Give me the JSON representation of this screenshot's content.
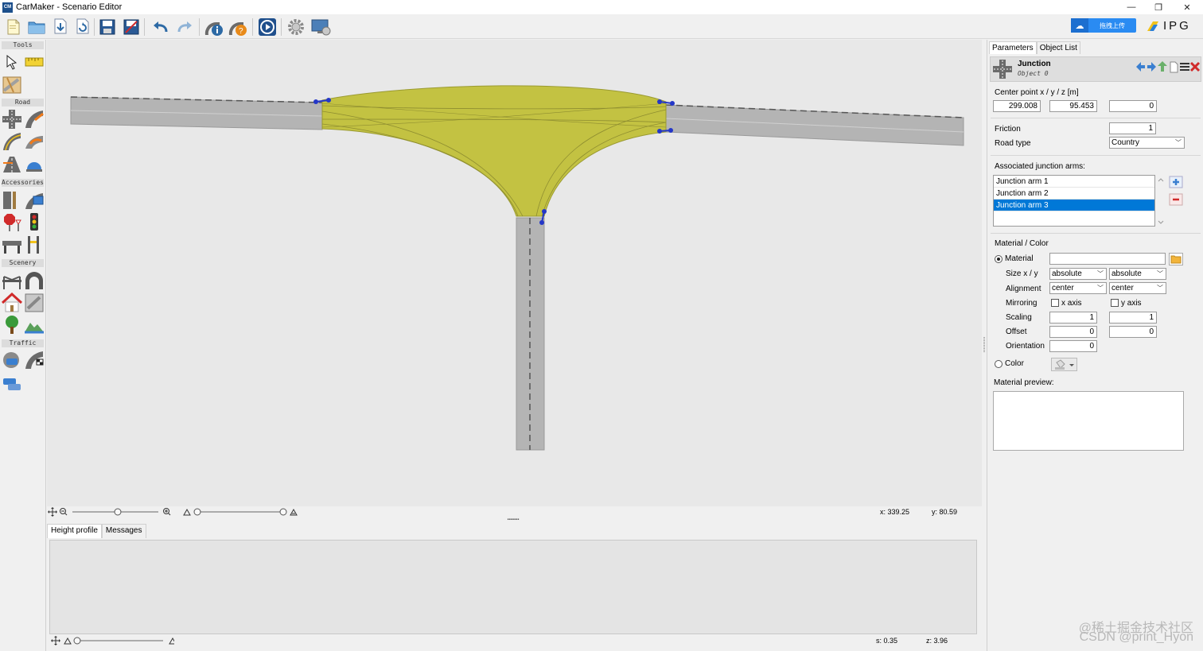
{
  "window": {
    "app_icon": "CM",
    "title": "CarMaker - Scenario Editor",
    "controls": [
      "—",
      "❐",
      "✕"
    ]
  },
  "toolbar": {
    "cloud_button": "拖拽上传",
    "brand": "IPG"
  },
  "left_panel": {
    "sections": [
      "Tools",
      "Road",
      "Accessories",
      "Scenery",
      "Traffic"
    ]
  },
  "canvas_status": {
    "x_label": "x: 339.25",
    "y_label": "y: 80.59"
  },
  "bottom": {
    "tabs": [
      "Height profile",
      "Messages"
    ],
    "s_label": "s: 0.35",
    "z_label": "z: 3.96"
  },
  "right_panel": {
    "tabs": [
      "Parameters",
      "Object List"
    ],
    "object_title": "Junction",
    "object_subtitle": "Object 0",
    "center_point_label": "Center point  x / y / z   [m]",
    "center_x": "299.008",
    "center_y": "95.453",
    "center_z": "0",
    "friction_label": "Friction",
    "friction_value": "1",
    "road_type_label": "Road type",
    "road_type_value": "Country",
    "arms_label": "Associated junction arms:",
    "arms": [
      "Junction arm 1",
      "Junction arm 2",
      "Junction arm 3"
    ],
    "material_color_label": "Material / Color",
    "material_label": "Material",
    "material_value": "",
    "size_label": "Size x / y",
    "size_x": "absolute",
    "size_y": "absolute",
    "alignment_label": "Alignment",
    "align_x": "center",
    "align_y": "center",
    "mirroring_label": "Mirroring",
    "mirror_x": "x axis",
    "mirror_y": "y axis",
    "scaling_label": "Scaling",
    "scaling_x": "1",
    "scaling_y": "1",
    "offset_label": "Offset",
    "offset_x": "0",
    "offset_y": "0",
    "orientation_label": "Orientation",
    "orientation_value": "0",
    "color_label": "Color",
    "material_preview_label": "Material preview:"
  },
  "watermark": {
    "line1": "@稀土掘金技术社区",
    "line2": "CSDN @print_Hyon"
  },
  "colors": {
    "junction_fill": "#c3c242",
    "road_gray": "#b4b4b4",
    "selection": "#0078d7",
    "handle_blue": "#2437c8"
  }
}
